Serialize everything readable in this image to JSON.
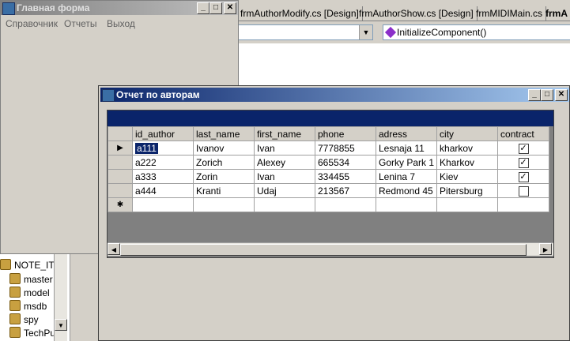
{
  "ide": {
    "tabs": [
      "frmAuthorModify.cs [Design]",
      "frmAuthorShow.cs [Design]",
      "frmMIDIMain.cs",
      "frmA"
    ],
    "member_combo": "InitializeComponent()",
    "tree_root": "NOTE_ITIS",
    "tree_items": [
      "master",
      "model",
      "msdb",
      "spy",
      "TechPu"
    ]
  },
  "main_form": {
    "title": "Главная форма",
    "menu": [
      "Справочник",
      "Отчеты",
      "Выход"
    ]
  },
  "report": {
    "title": "Отчет по авторам",
    "columns": [
      "id_author",
      "last_name",
      "first_name",
      "phone",
      "adress",
      "city",
      "contract"
    ],
    "rows": [
      {
        "id_author": "a111",
        "last_name": "Ivanov",
        "first_name": "Ivan",
        "phone": "7778855",
        "adress": "Lesnaja 11",
        "city": "kharkov",
        "contract": true
      },
      {
        "id_author": "a222",
        "last_name": "Zorich",
        "first_name": "Alexey",
        "phone": "665534",
        "adress": "Gorky Park 1",
        "city": "Kharkov",
        "contract": true
      },
      {
        "id_author": "a333",
        "last_name": "Zorin",
        "first_name": "Ivan",
        "phone": "334455",
        "adress": "Lenina 7",
        "city": "Kiev",
        "contract": true
      },
      {
        "id_author": "a444",
        "last_name": "Kranti",
        "first_name": "Udaj",
        "phone": "213567",
        "adress": "Redmond 45",
        "city": "Pitersburg",
        "contract": false
      }
    ],
    "current_row_marker": "▶",
    "new_row_marker": "✱"
  }
}
